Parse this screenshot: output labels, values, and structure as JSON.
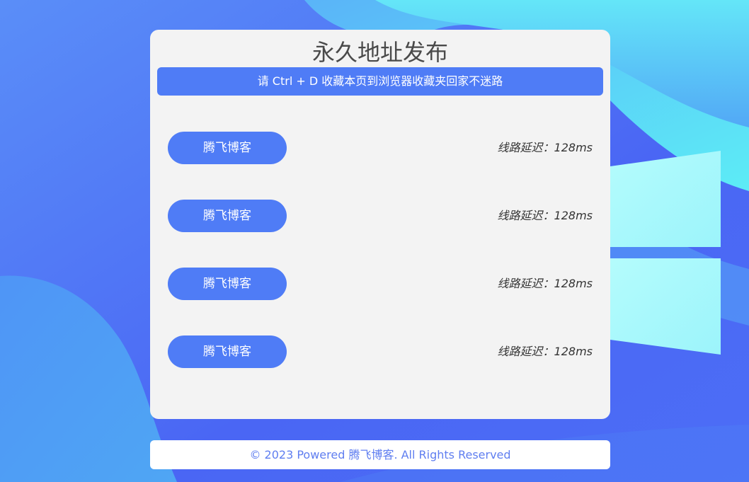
{
  "page": {
    "title": "永久地址发布",
    "notice": "请 Ctrl + D 收藏本页到浏览器收藏夹回家不迷路"
  },
  "lines": [
    {
      "label": "腾飞博客",
      "latency_label": "线路延迟：",
      "latency_value": "128ms"
    },
    {
      "label": "腾飞博客",
      "latency_label": "线路延迟：",
      "latency_value": "128ms"
    },
    {
      "label": "腾飞博客",
      "latency_label": "线路延迟：",
      "latency_value": "128ms"
    },
    {
      "label": "腾飞博客",
      "latency_label": "线路延迟：",
      "latency_value": "128ms"
    }
  ],
  "footer": {
    "text": "© 2023 Powered 腾飞博客. All Rights Reserved"
  },
  "colors": {
    "accent": "#4f7cf6",
    "background_blue": "#4a68f5",
    "background_cyan": "#5ee3f7",
    "card": "#f3f3f3"
  },
  "icons": {
    "background_logo": "windows-logo-icon"
  }
}
